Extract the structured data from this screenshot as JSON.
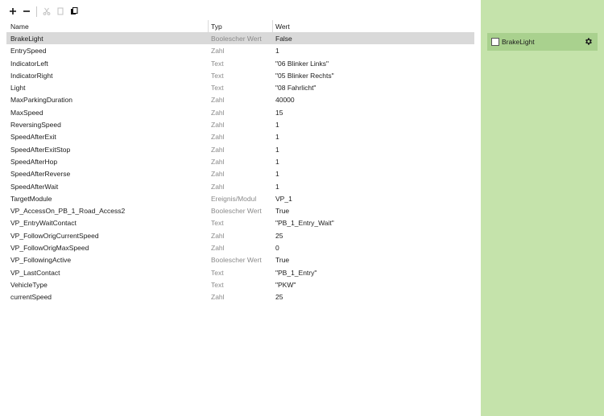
{
  "toolbar": {
    "add_icon": "plus-icon",
    "remove_icon": "minus-icon",
    "cut_icon": "scissors-icon",
    "copy_icon": "copy-icon",
    "paste_icon": "paste-icon"
  },
  "columns": {
    "name": "Name",
    "typ": "Typ",
    "wert": "Wert"
  },
  "rows": [
    {
      "name": "BrakeLight",
      "typ": "Boolescher Wert",
      "wert": "False"
    },
    {
      "name": "EntrySpeed",
      "typ": "Zahl",
      "wert": "1"
    },
    {
      "name": "IndicatorLeft",
      "typ": "Text",
      "wert": "\"06 Blinker Links\""
    },
    {
      "name": "IndicatorRight",
      "typ": "Text",
      "wert": "\"05 Blinker Rechts\""
    },
    {
      "name": "Light",
      "typ": "Text",
      "wert": "\"08 Fahrlicht\""
    },
    {
      "name": "MaxParkingDuration",
      "typ": "Zahl",
      "wert": "40000"
    },
    {
      "name": "MaxSpeed",
      "typ": "Zahl",
      "wert": "15"
    },
    {
      "name": "ReversingSpeed",
      "typ": "Zahl",
      "wert": "1"
    },
    {
      "name": "SpeedAfterExit",
      "typ": "Zahl",
      "wert": "1"
    },
    {
      "name": "SpeedAfterExitStop",
      "typ": "Zahl",
      "wert": "1"
    },
    {
      "name": "SpeedAfterHop",
      "typ": "Zahl",
      "wert": "1"
    },
    {
      "name": "SpeedAfterReverse",
      "typ": "Zahl",
      "wert": "1"
    },
    {
      "name": "SpeedAfterWait",
      "typ": "Zahl",
      "wert": "1"
    },
    {
      "name": "TargetModule",
      "typ": "Ereignis/Modul",
      "wert": "VP_1"
    },
    {
      "name": "VP_AccessOn_PB_1_Road_Access2",
      "typ": "Boolescher Wert",
      "wert": "True"
    },
    {
      "name": "VP_EntryWaitContact",
      "typ": "Text",
      "wert": "\"PB_1_Entry_Wait\""
    },
    {
      "name": "VP_FollowOrigCurrentSpeed",
      "typ": "Zahl",
      "wert": "25"
    },
    {
      "name": "VP_FollowOrigMaxSpeed",
      "typ": "Zahl",
      "wert": "0"
    },
    {
      "name": "VP_FollowingActive",
      "typ": "Boolescher Wert",
      "wert": "True"
    },
    {
      "name": "VP_LastContact",
      "typ": "Text",
      "wert": "\"PB_1_Entry\""
    },
    {
      "name": "VehicleType",
      "typ": "Text",
      "wert": "\"PKW\""
    },
    {
      "name": "currentSpeed",
      "typ": "Zahl",
      "wert": "25"
    }
  ],
  "selected_row": 0,
  "side_panel": {
    "item_label": "BrakeLight",
    "item_checked": false,
    "settings_icon": "gear-icon"
  },
  "colors": {
    "side_panel_bg": "#c5e3ab",
    "side_item_bg": "#a9d18e",
    "selected_row_bg": "#d9d9d9"
  }
}
